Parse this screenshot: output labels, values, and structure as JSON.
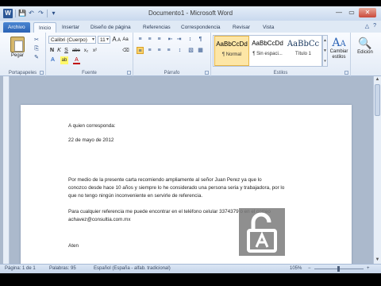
{
  "window": {
    "title": "Documento1 - Microsoft Word"
  },
  "qat": {
    "app_icon": "W",
    "save": "💾",
    "undo": "↶",
    "redo": "↷",
    "customize": "▾"
  },
  "winctl": {
    "minimize": "—",
    "restore": "▭",
    "close": "✕"
  },
  "tabs": [
    {
      "label": "Archivo"
    },
    {
      "label": "Inicio"
    },
    {
      "label": "Insertar"
    },
    {
      "label": "Diseño de página"
    },
    {
      "label": "Referencias"
    },
    {
      "label": "Correspondencia"
    },
    {
      "label": "Revisar"
    },
    {
      "label": "Vista"
    }
  ],
  "tab_right": {
    "collapse": "△",
    "help": "?"
  },
  "ribbon": {
    "clipboard": {
      "label": "Portapapeles",
      "paste": "Pegar"
    },
    "font": {
      "label": "Fuente",
      "family": "Calibri (Cuerpo)",
      "size": "11",
      "grow": "A",
      "shrink": "A",
      "case": "Aa",
      "clear": "⌫",
      "bold": "N",
      "italic": "K",
      "underline": "S",
      "strike": "abe",
      "subscript": "x₂",
      "superscript": "x²",
      "effects": "A",
      "highlight": "ab",
      "color": "A"
    },
    "paragraph": {
      "label": "Párrafo",
      "bullets": "≡",
      "numbering": "≡",
      "multilevel": "≡",
      "decrease": "⇤",
      "increase": "⇥",
      "sort": "↕",
      "marks": "¶",
      "align_left": "≡",
      "align_center": "≡",
      "align_right": "≡",
      "justify": "≡",
      "spacing": "↕",
      "shading": "▧",
      "borders": "▦"
    },
    "styles": {
      "label": "Estilos",
      "items": [
        {
          "sample": "AaBbCcDd",
          "name": "¶ Normal"
        },
        {
          "sample": "AaBbCcDd",
          "name": "¶ Sin espaci..."
        },
        {
          "sample": "AaBbCc",
          "name": "Título 1"
        }
      ],
      "scroll_up": "▲",
      "scroll_down": "▼",
      "more": "▾",
      "change_styles": "Cambiar estilos",
      "change_styles_icon": "A",
      "change_styles_icon_small": "A"
    },
    "editing": {
      "label": "Edición",
      "icon": "🔍"
    }
  },
  "document": {
    "lines": [
      "A quien corresponda:",
      "22 de mayo de 2012",
      "            Por medio de la presente carta recomiendo ampliamente al señor Juan Perez ya que lo",
      "conozco desde hace 10 años y siempre lo he considerado una persona seria y trabajadora, por lo",
      "que no tengo ningún inconveniente en servirle de referencia.",
      "Para cualquier referencia me puede encontrar en el teléfono celular 3374379 o en el correo",
      "achavez@consultia.com.mx",
      "Aten"
    ]
  },
  "statusbar": {
    "page": "Página: 1 de 1",
    "words": "Palabras: 95",
    "language": "Español (España - alfab. tradicional)",
    "zoom": "105%",
    "zoom_out": "−",
    "zoom_in": "+"
  },
  "colors": {
    "accent": "#2b63b5",
    "highlight": "#fbd36b",
    "font_color": "#c00000"
  }
}
